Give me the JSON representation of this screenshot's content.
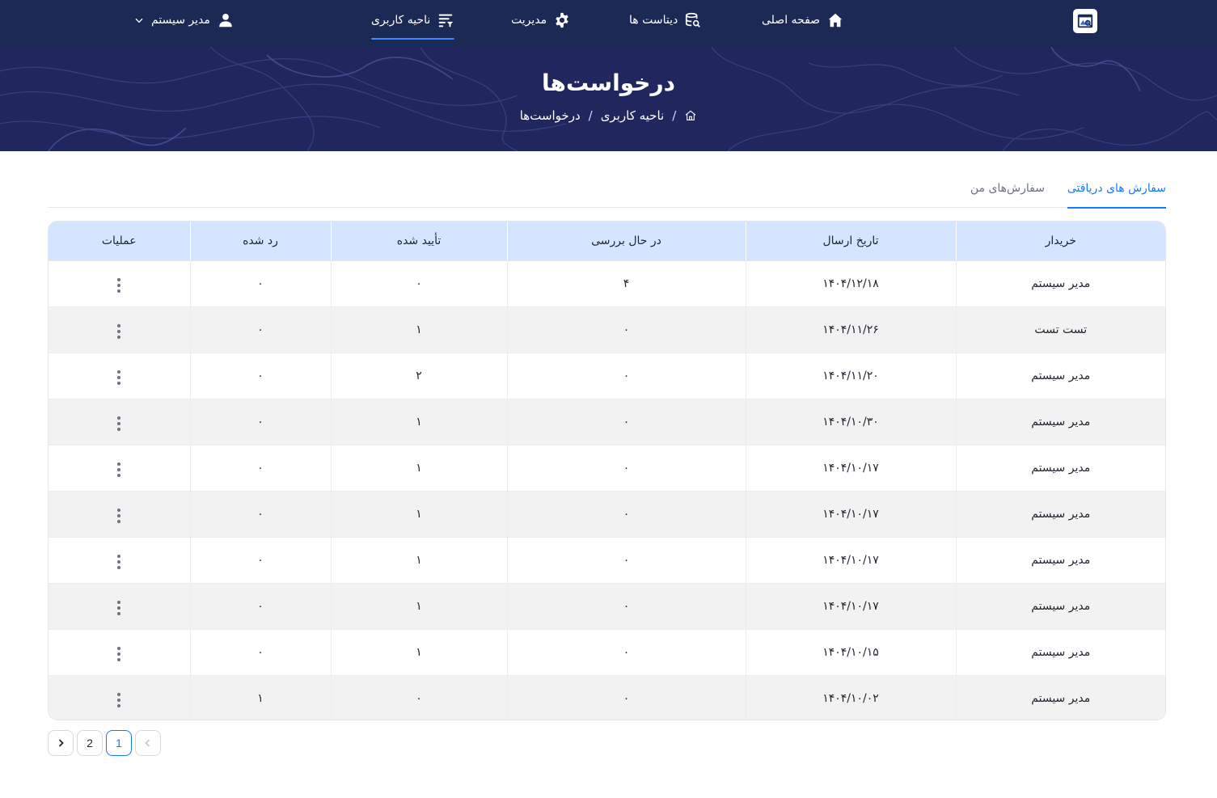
{
  "nav": {
    "home": "صفحه اصلی",
    "datasets": "دیتاست ها",
    "management": "مدیریت",
    "user_area": "ناحیه کاربری",
    "user_name": "مدیر سیستم"
  },
  "hero": {
    "title": "درخواست‌ها",
    "breadcrumb": [
      "ناحیه کاربری",
      "درخواست‌ها"
    ],
    "separator": "/"
  },
  "tabs": {
    "received": "سفارش های دریافتی",
    "mine": "سفارش‌های من"
  },
  "table": {
    "headers": [
      "خریدار",
      "تاریخ ارسال",
      "در حال بررسی",
      "تأیید شده",
      "رد شده",
      "عملیات"
    ],
    "rows": [
      {
        "buyer": "مدیر سیستم",
        "date": "۱۴۰۴/۱۲/۱۸",
        "pending": "۴",
        "approved": "۰",
        "rejected": "۰"
      },
      {
        "buyer": "تست تست",
        "date": "۱۴۰۴/۱۱/۲۶",
        "pending": "۰",
        "approved": "۱",
        "rejected": "۰"
      },
      {
        "buyer": "مدیر سیستم",
        "date": "۱۴۰۴/۱۱/۲۰",
        "pending": "۰",
        "approved": "۲",
        "rejected": "۰"
      },
      {
        "buyer": "مدیر سیستم",
        "date": "۱۴۰۴/۱۰/۳۰",
        "pending": "۰",
        "approved": "۱",
        "rejected": "۰"
      },
      {
        "buyer": "مدیر سیستم",
        "date": "۱۴۰۴/۱۰/۱۷",
        "pending": "۰",
        "approved": "۱",
        "rejected": "۰"
      },
      {
        "buyer": "مدیر سیستم",
        "date": "۱۴۰۴/۱۰/۱۷",
        "pending": "۰",
        "approved": "۱",
        "rejected": "۰"
      },
      {
        "buyer": "مدیر سیستم",
        "date": "۱۴۰۴/۱۰/۱۷",
        "pending": "۰",
        "approved": "۱",
        "rejected": "۰"
      },
      {
        "buyer": "مدیر سیستم",
        "date": "۱۴۰۴/۱۰/۱۷",
        "pending": "۰",
        "approved": "۱",
        "rejected": "۰"
      },
      {
        "buyer": "مدیر سیستم",
        "date": "۱۴۰۴/۱۰/۱۵",
        "pending": "۰",
        "approved": "۱",
        "rejected": "۰"
      },
      {
        "buyer": "مدیر سیستم",
        "date": "۱۴۰۴/۱۰/۰۲",
        "pending": "۰",
        "approved": "۰",
        "rejected": "۱"
      }
    ]
  },
  "pagination": {
    "pages": [
      "1",
      "2"
    ],
    "current": "1"
  },
  "colors": {
    "nav_bg": "#1b2a55",
    "hero_bg": "#20275e",
    "accent": "#1677ff",
    "header_bg": "#d4e5ff",
    "row_alt": "#f2f2f3"
  },
  "icons": {
    "logo": "dataset-logo-icon",
    "home": "home-icon",
    "datasets": "database-search-icon",
    "management": "gear-icon",
    "user_area": "list-filter-icon",
    "user": "user-icon",
    "dropdown": "chevron-down-icon",
    "row_actions": "more-vertical-icon"
  }
}
